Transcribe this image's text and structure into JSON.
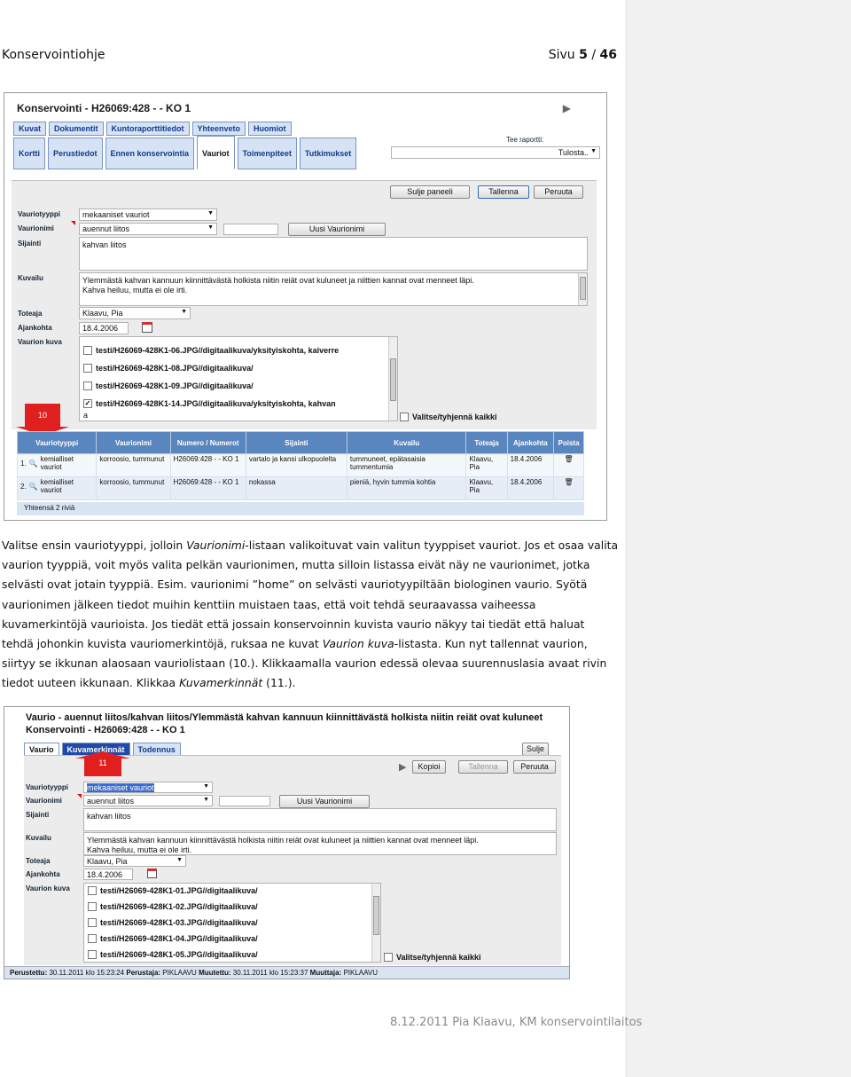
{
  "header": {
    "title": "Konservointiohje",
    "page_label": "Sivu",
    "page": "5",
    "separator": "/",
    "total": "46"
  },
  "screenshot1": {
    "title": "Konservointi  - H26069:428 - - KO 1",
    "top_tabs": [
      "Kuvat",
      "Dokumentit",
      "Kuntoraporttitiedot",
      "Yhteenveto",
      "Huomiot"
    ],
    "main_tabs": [
      "Kortti",
      "Perustiedot",
      "Ennen konservointia",
      "Vauriot",
      "Toimenpiteet",
      "Tutkimukset"
    ],
    "active_tab": "Vauriot",
    "report_label": "Tee raportti:",
    "report_select": "Tulosta..",
    "buttons": {
      "close_panels": "Sulje paneeli",
      "save": "Tallenna",
      "cancel": "Peruuta",
      "new_damage": "Uusi Vaurionimi"
    },
    "labels": {
      "type": "Vauriotyyppi",
      "name": "Vaurionimi",
      "location": "Sijainti",
      "description": "Kuvailu",
      "performer": "Toteaja",
      "date": "Ajankohta",
      "image": "Vaurion kuva"
    },
    "values": {
      "type": "mekaaniset vauriot",
      "name": "auennut liitos",
      "location": "kahvan liitos",
      "description_line1": "Ylemmästä kahvan kannuun kiinnittävästä holkista niitin reiät ovat kuluneet ja niittien kannat ovat menneet läpi.",
      "description_line2": "Kahva heiluu, mutta ei ole irti.",
      "performer": "Klaavu, Pia",
      "date": "18.4.2006"
    },
    "images": [
      {
        "path": "testi/H26069-428K1-06.JPG//digitaalikuva/yksityiskohta, kaiverre",
        "checked": false
      },
      {
        "path": "testi/H26069-428K1-08.JPG//digitaalikuva/",
        "checked": false
      },
      {
        "path": "testi/H26069-428K1-09.JPG//digitaalikuva/",
        "checked": false
      },
      {
        "path": "testi/H26069-428K1-14.JPG//digitaalikuva/yksityiskohta, kahvan",
        "checked": true
      }
    ],
    "images_extra": "a",
    "select_all": "Valitse/tyhjennä kaikki",
    "callout": "10",
    "table": {
      "headers": [
        "Vauriotyyppi",
        "Vaurionimi",
        "Numero / Numerot",
        "Sijainti",
        "Kuvailu",
        "Toteaja",
        "Ajankohta",
        "Poista"
      ],
      "rows": [
        {
          "idx": "1.",
          "type": "kemialliset vauriot",
          "name": "korroosio, tummunut",
          "number": "H26069:428 - - KO 1",
          "location": "vartalo ja kansi ulkopuolelta",
          "description": "tummuneet, epätasaisia tummentumia",
          "performer": "Klaavu, Pia",
          "date": "18.4.2006"
        },
        {
          "idx": "2.",
          "type": "kemialliset vauriot",
          "name": "korroosio, tummunut",
          "number": "H26069:428 - - KO 1",
          "location": "nokassa",
          "description": "pieniä, hyvin tummia kohtia",
          "performer": "Klaavu, Pia",
          "date": "18.4.2006"
        }
      ],
      "footer": "Yhteensä 2 riviä"
    }
  },
  "paragraph": {
    "p1": "Valitse ensin vauriotyyppi, jolloin ",
    "p1_italic": "Vaurionimi",
    "p2": "-listaan valikoituvat vain valitun tyyppiset vauriot. Jos et osaa valita vaurion tyyppiä, voit myös valita pelkän vaurionimen, mutta silloin listassa eivät näy ne vaurionimet, jotka selvästi ovat jotain tyyppiä. Esim. vaurionimi ”home” on selvästi vauriotyypiltään biologinen vaurio. Syötä vaurionimen jälkeen tiedot muihin kenttiin muistaen taas, että voit tehdä seuraavassa vaiheessa kuvamerkintöjä vaurioista. Jos tiedät että jossain konservoinnin kuvista vaurio näkyy tai tiedät että haluat tehdä johonkin kuvista vauriomerkintöjä, ruksaa ne kuvat ",
    "p2_italic": "Vaurion kuva",
    "p3": "-listasta. Kun nyt tallennat vaurion, siirtyy se ikkunan alaosaan vauriolistaan (10.). Klikkaamalla vaurion edessä olevaa suurennuslasia avaat rivin tiedot uuteen ikkunaan. Klikkaa ",
    "p3_italic": "Kuvamerkinnät",
    "p4": " (11.)."
  },
  "screenshot2": {
    "title_line1": "Vaurio  - auennut liitos/kahvan liitos/Ylemmästä kahvan kannuun kiinnittävästä holkista niitin reiät ovat kuluneet",
    "title_line2": "Konservointi - H26069:428 - - KO 1",
    "tabs": [
      "Vaurio",
      "Kuvamerkinnät",
      "Todennus"
    ],
    "active_tab": "Kuvamerkinnät",
    "buttons": {
      "close": "Sulje",
      "copy": "Kopioi",
      "save": "Tallenna",
      "cancel": "Peruuta",
      "new_damage": "Uusi Vaurionimi"
    },
    "callout": "11",
    "labels": {
      "type": "Vauriotyyppi",
      "name": "Vaurionimi",
      "location": "Sijainti",
      "description": "Kuvailu",
      "performer": "Toteaja",
      "date": "Ajankohta",
      "image": "Vaurion kuva"
    },
    "values": {
      "type": "mekaaniset vauriot",
      "name": "auennut liitos",
      "location": "kahvan liitos",
      "description_line1": "Ylemmästä kahvan kannuun kiinnittävästä holkista niitin reiät ovat kuluneet ja niittien kannat ovat menneet läpi.",
      "description_line2": "Kahva heiluu, mutta ei ole irti.",
      "performer": "Klaavu, Pia",
      "date": "18.4.2006"
    },
    "images": [
      "testi/H26069-428K1-01.JPG//digitaalikuva/",
      "testi/H26069-428K1-02.JPG//digitaalikuva/",
      "testi/H26069-428K1-03.JPG//digitaalikuva/",
      "testi/H26069-428K1-04.JPG//digitaalikuva/",
      "testi/H26069-428K1-05.JPG//digitaalikuva/"
    ],
    "select_all": "Valitse/tyhjennä kaikki",
    "footer": {
      "created_label": "Perustettu:",
      "created": "30.11.2011 klo 15:23:24",
      "by_label": "Perustaja:",
      "by": "PIKLAAVU",
      "modified_label": "Muutettu:",
      "modified": "30.11.2011 klo 15:23:37",
      "modifier_label": "Muuttaja:",
      "modifier": "PIKLAAVU"
    }
  },
  "footer": "8.12.2011 Pia Klaavu, KM konservointilaitos",
  "colors": {
    "tab_bg": "#d6e3f5",
    "tab_text": "#143a8a",
    "grid_header": "#5a86bf",
    "callout": "#e0201f"
  }
}
